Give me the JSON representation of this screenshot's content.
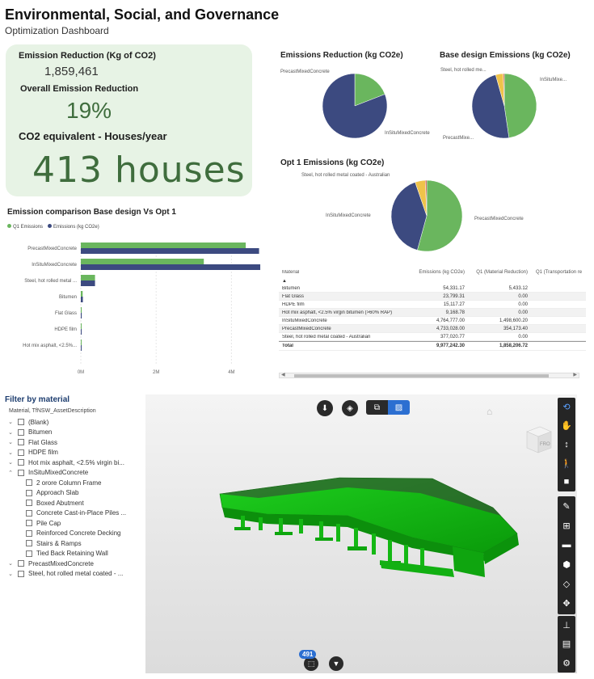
{
  "header": {
    "title": "Environmental, Social, and Governance",
    "subtitle": "Optimization Dashboard"
  },
  "kpi": {
    "emission_reduction_label": "Emission Reduction (Kg of CO2)",
    "emission_reduction_value": "1,859,461",
    "overall_label": "Overall Emission Reduction",
    "overall_value": "19%",
    "houses_label": "CO2 equivalent - Houses/year",
    "houses_value": "413 houses"
  },
  "pies": {
    "reduction": {
      "title": "Emissions Reduction (kg CO2e)",
      "labels": [
        "PrecastMixedConcrete",
        "InSituMixedConcrete"
      ]
    },
    "base": {
      "title": "Base design Emissions (kg CO2e)",
      "labels": [
        "Steel, hot rolled me...",
        "InSituMixe...",
        "PrecastMixe..."
      ]
    },
    "opt1": {
      "title": "Opt 1 Emissions (kg CO2e)",
      "labels": [
        "Steel, hot rolled metal coated - Australian",
        "InSituMixedConcrete",
        "PrecastMixedConcrete"
      ]
    }
  },
  "colors": {
    "green": "#6ab65e",
    "navy": "#3c4a80",
    "yellow": "#efc34a",
    "red": "#c8463a",
    "kpi_bg": "#e7f3e5",
    "kpi_text": "#3f6d3d"
  },
  "bar_chart": {
    "title": "Emission comparison Base design Vs Opt 1",
    "legend": [
      "Q1 Emissions",
      "Emissions (kg CO2e)"
    ]
  },
  "chart_data": [
    {
      "type": "pie",
      "title": "Emissions Reduction (kg CO2e)",
      "categories": [
        "PrecastMixedConcrete",
        "InSituMixedConcrete"
      ],
      "values": [
        354173.4,
        1498600.2
      ]
    },
    {
      "type": "pie",
      "title": "Base design Emissions (kg CO2e)",
      "categories": [
        "PrecastMixedConcrete",
        "InSituMixedConcrete",
        "Steel, hot rolled metal coated - Australian",
        "Bitumen"
      ],
      "values": [
        4733028.0,
        4764777.0,
        377020.77,
        54331.17
      ]
    },
    {
      "type": "pie",
      "title": "Opt 1 Emissions (kg CO2e)",
      "categories": [
        "PrecastMixedConcrete",
        "InSituMixedConcrete",
        "Steel, hot rolled metal coated - Australian",
        "Bitumen"
      ],
      "values": [
        4378854.6,
        3266176.8,
        377020.77,
        48898.05
      ]
    },
    {
      "type": "bar",
      "title": "Emission comparison Base design Vs Opt 1",
      "categories": [
        "PrecastMixedConcrete",
        "InSituMixedConcrete",
        "Steel, hot rolled metal ...",
        "Bitumen",
        "Flat Glass",
        "HDPE film",
        "Hot mix asphalt, <2.5%..."
      ],
      "series": [
        {
          "name": "Q1 Emissions",
          "values": [
            4378854.6,
            3266176.8,
            377020.77,
            48898.05,
            23799.31,
            15117.27,
            9168.78
          ]
        },
        {
          "name": "Emissions (kg CO2e)",
          "values": [
            4733028.0,
            4764777.0,
            377020.77,
            54331.17,
            23799.31,
            15117.27,
            9168.78
          ]
        }
      ],
      "xlim": [
        0,
        5000000
      ],
      "xticks": [
        "0M",
        "2M",
        "4M"
      ]
    }
  ],
  "table": {
    "headers": [
      "Material",
      "Emissions (kg CO2e)",
      "Q1 (Material Reduction)",
      "Q1 (Transportation re"
    ],
    "rows": [
      [
        "Bitumen",
        "54,331.17",
        "5,433.12"
      ],
      [
        "Flat Glass",
        "23,799.31",
        "0.00"
      ],
      [
        "HDPE film",
        "15,117.27",
        "0.00"
      ],
      [
        "Hot mix asphalt, <2.5% virgin bitumen (>60% RAP)",
        "9,168.78",
        "0.00"
      ],
      [
        "InSituMixedConcrete",
        "4,764,777.00",
        "1,498,600.20"
      ],
      [
        "PrecastMixedConcrete",
        "4,733,028.00",
        "354,173.40"
      ],
      [
        "Steel, hot rolled metal coated - Australian",
        "377,020.77",
        "0.00"
      ]
    ],
    "total": [
      "Total",
      "9,977,242.30",
      "1,858,206.72"
    ]
  },
  "filter": {
    "title": "Filter by material",
    "subtitle": "Material, TfNSW_AssetDescription",
    "items": [
      {
        "label": "(Blank)",
        "level": 0,
        "expanded": false
      },
      {
        "label": "Bitumen",
        "level": 0,
        "expanded": false
      },
      {
        "label": "Flat Glass",
        "level": 0,
        "expanded": false
      },
      {
        "label": "HDPE film",
        "level": 0,
        "expanded": false
      },
      {
        "label": "Hot mix asphalt, <2.5% virgin bi...",
        "level": 0,
        "expanded": false
      },
      {
        "label": "InSituMixedConcrete",
        "level": 0,
        "expanded": true
      },
      {
        "label": "2 orore Column Frame",
        "level": 1
      },
      {
        "label": "Approach Slab",
        "level": 1
      },
      {
        "label": "Boxed Abutment",
        "level": 1
      },
      {
        "label": "Concrete Cast-in-Place Piles ...",
        "level": 1
      },
      {
        "label": "Pile Cap",
        "level": 1
      },
      {
        "label": "Reinforced Concrete Decking",
        "level": 1
      },
      {
        "label": "Stairs & Ramps",
        "level": 1
      },
      {
        "label": "Tied Back Retaining Wall",
        "level": 1
      },
      {
        "label": "PrecastMixedConcrete",
        "level": 0,
        "expanded": false
      },
      {
        "label": "Steel, hot rolled metal coated - ...",
        "level": 0,
        "expanded": false
      }
    ]
  },
  "viewer": {
    "badge": "491",
    "cube_label": "FRO",
    "icons": [
      "orbit-icon",
      "pan-icon",
      "zoom-icon",
      "walk-icon",
      "camera-icon",
      "markup-icon",
      "measure-icon",
      "section-icon",
      "explode-icon",
      "layers-icon",
      "properties-icon",
      "model-browser-icon",
      "document-icon",
      "settings-icon"
    ]
  }
}
